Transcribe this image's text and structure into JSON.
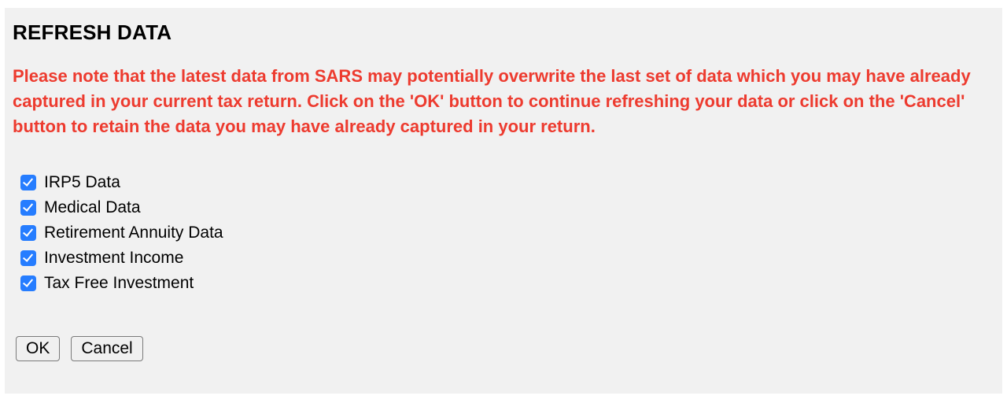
{
  "dialog": {
    "title": "REFRESH DATA",
    "warning": "Please note that the latest data from SARS may potentially overwrite the last set of data which you may have already captured in your current tax return. Click on the 'OK' button to continue refreshing your data or click on the 'Cancel' button to retain the data you may have already captured in your return.",
    "options": [
      {
        "label": "IRP5 Data",
        "checked": true
      },
      {
        "label": "Medical Data",
        "checked": true
      },
      {
        "label": "Retirement Annuity Data",
        "checked": true
      },
      {
        "label": "Investment Income",
        "checked": true
      },
      {
        "label": "Tax Free Investment",
        "checked": true
      }
    ],
    "buttons": {
      "ok": "OK",
      "cancel": "Cancel"
    }
  }
}
